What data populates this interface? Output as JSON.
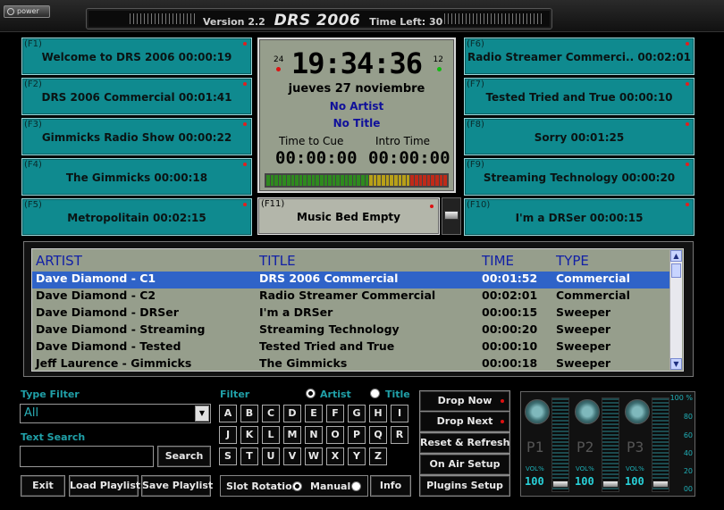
{
  "titlebar": {
    "power_label": "power",
    "version": "Version 2.2",
    "logo": "DRS 2006",
    "time_left": "Time Left: 30"
  },
  "carts_left": [
    {
      "key": "(F1)",
      "label": "Welcome to DRS 2006 00:00:19"
    },
    {
      "key": "(F2)",
      "label": "DRS 2006 Commercial 00:01:41"
    },
    {
      "key": "(F3)",
      "label": "Gimmicks Radio Show 00:00:22"
    },
    {
      "key": "(F4)",
      "label": "The Gimmicks 00:00:18"
    },
    {
      "key": "(F5)",
      "label": "Metropolitain 00:02:15"
    }
  ],
  "carts_right": [
    {
      "key": "(F6)",
      "label": "Radio Streamer Commerci.. 00:02:01"
    },
    {
      "key": "(F7)",
      "label": "Tested Tried and True 00:00:10"
    },
    {
      "key": "(F8)",
      "label": "Sorry 00:01:25"
    },
    {
      "key": "(F9)",
      "label": "Streaming Technology 00:00:20"
    },
    {
      "key": "(F10)",
      "label": "I'm a DRSer 00:00:15"
    }
  ],
  "clock": {
    "h24": "24",
    "h12": "12",
    "time": "19:34:36",
    "date": "jueves 27 noviembre",
    "artist": "No Artist",
    "title": "No Title",
    "cue_label": "Time to Cue",
    "intro_label": "Intro Time",
    "cue_value": "00:00:00",
    "intro_value": "00:00:00"
  },
  "f11": {
    "key": "(F11)",
    "label": "Music Bed Empty"
  },
  "playlist": {
    "headers": {
      "artist": "ARTIST",
      "title": "TITLE",
      "time": "TIME",
      "type": "TYPE"
    },
    "rows": [
      {
        "artist": "Dave Diamond - C1",
        "title": "DRS 2006 Commercial",
        "time": "00:01:52",
        "type": "Commercial"
      },
      {
        "artist": "Dave Diamond - C2",
        "title": "Radio Streamer Commercial",
        "time": "00:02:01",
        "type": "Commercial"
      },
      {
        "artist": "Dave Diamond - DRSer",
        "title": "I'm a DRSer",
        "time": "00:00:15",
        "type": "Sweeper"
      },
      {
        "artist": "Dave Diamond - Streaming",
        "title": "Streaming Technology",
        "time": "00:00:20",
        "type": "Sweeper"
      },
      {
        "artist": "Dave Diamond - Tested",
        "title": "Tested Tried and True",
        "time": "00:00:10",
        "type": "Sweeper"
      },
      {
        "artist": "Jeff Laurence - Gimmicks",
        "title": "The Gimmicks",
        "time": "00:00:18",
        "type": "Sweeper"
      }
    ]
  },
  "type_filter": {
    "label": "Type Filter",
    "value": "All"
  },
  "text_search": {
    "label": "Text Search",
    "value": "",
    "button": "Search"
  },
  "filter": {
    "label": "Filter",
    "artist_label": "Artist",
    "title_label": "Title",
    "keys": [
      "A",
      "B",
      "C",
      "D",
      "E",
      "F",
      "G",
      "H",
      "I",
      "J",
      "K",
      "L",
      "M",
      "N",
      "O",
      "P",
      "Q",
      "R",
      "S",
      "T",
      "U",
      "V",
      "W",
      "X",
      "Y",
      "Z"
    ]
  },
  "buttons": {
    "exit": "Exit",
    "load_playlist": "Load Playlist",
    "save_playlist": "Save Playlist",
    "slot_rotation": "Slot Rotation",
    "manual": "Manual",
    "info": "Info",
    "drop_now": "Drop Now",
    "drop_next": "Drop Next",
    "reset_refresh": "Reset & Refresh",
    "on_air_setup": "On Air Setup",
    "plugins_setup": "Plugins Setup"
  },
  "mixer": {
    "channels": [
      {
        "name": "P1",
        "vol_label": "VOL%",
        "vol": "100"
      },
      {
        "name": "P2",
        "vol_label": "VOL%",
        "vol": "100"
      },
      {
        "name": "P3",
        "vol_label": "VOL%",
        "vol": "100"
      }
    ],
    "scale": [
      "100 %",
      "80",
      "60",
      "40",
      "20",
      "00"
    ]
  },
  "colors": {
    "cart_teal": "#0f8a8f",
    "panel_gray": "#969e8c",
    "selected_row": "#2f63c8",
    "accent_blue": "#1220a6",
    "label_teal": "#20a0a8"
  }
}
